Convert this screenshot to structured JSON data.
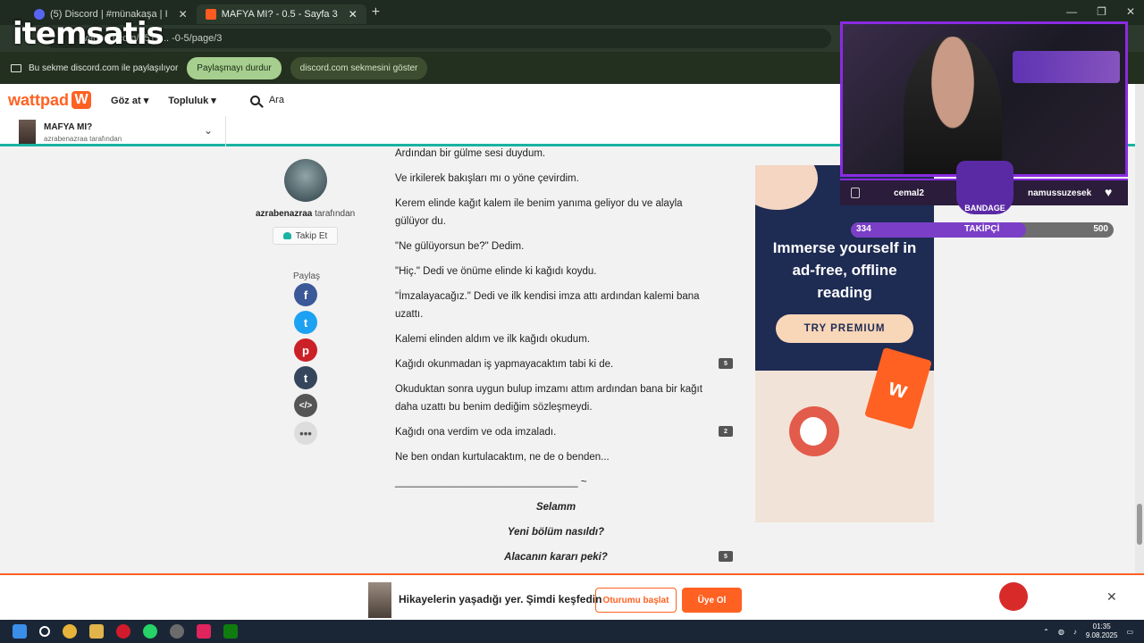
{
  "browser": {
    "tabs": [
      {
        "label": "(5) Discord | #münakaşa | I",
        "active": false
      },
      {
        "label": "MAFYA MI? - 0.5 - Sayfa 3",
        "active": true
      }
    ],
    "address": "wattpad.com/1514... -0-5/page/3",
    "overlay_logo": "itemsatis",
    "share_notice": "Bu sekme discord.com ile paylaşılıyor",
    "stop_sharing": "Paylaşmayı durdur",
    "show_tab": "discord.com sekmesini göster"
  },
  "nav": {
    "logo": "wattpad",
    "browse": "Göz at",
    "community": "Topluluk",
    "search_placeholder": "Ara"
  },
  "story_header": {
    "title": "MAFYA MI?",
    "byline": "azrabenazraa tarafından"
  },
  "author": {
    "name": "azrabenazraa",
    "suffix": " tarafından",
    "follow": "Takip Et",
    "share_label": "Paylaş"
  },
  "paragraphs": [
    {
      "text": "Ardından bir gülme sesi duydum.",
      "comments": ""
    },
    {
      "text": "Ve irkilerek bakışları mı o yöne çevirdim.",
      "comments": ""
    },
    {
      "text": "Kerem elinde kağıt kalem ile benim yanıma geliyor du ve alayla gülüyor du.",
      "comments": ""
    },
    {
      "text": "\"Ne gülüyorsun be?\" Dedim.",
      "comments": ""
    },
    {
      "text": "\"Hiç.\" Dedi ve önüme elinde ki kağıdı koydu.",
      "comments": ""
    },
    {
      "text": "\"İmzalayacağız.\" Dedi ve ilk kendisi imza attı ardından kalemi bana uzattı.",
      "comments": ""
    },
    {
      "text": "Kalemi elinden aldım ve ilk kağıdı okudum.",
      "comments": ""
    },
    {
      "text": "Kağıdı okunmadan iş yapmayacaktım tabi ki de.",
      "comments": "5"
    },
    {
      "text": "Okuduktan sonra uygun bulup imzamı attım ardından bana bir kağıt daha uzattı bu benim dediğim sözleşmeydi.",
      "comments": ""
    },
    {
      "text": "Kağıdı ona verdim ve oda imzaladı.",
      "comments": "2"
    },
    {
      "text": "Ne ben ondan kurtulacaktım, ne de o benden...",
      "comments": ""
    },
    {
      "text": "________________________________ ~",
      "comments": ""
    },
    {
      "text": "Selamm",
      "comments": ""
    },
    {
      "text": "Yeni bölüm nasıldı?",
      "comments": ""
    },
    {
      "text": "Alacanın kararı peki?",
      "comments": "5"
    }
  ],
  "ad": {
    "headline": "Immerse yourself in ad-free, offline reading",
    "cta": "TRY PREMIUM"
  },
  "bottom_bar": {
    "promo": "Hikayelerin yaşadığı yer. Şimdi keşfedin",
    "start_reading": "Oturumu başlat",
    "join": "Üye Ol"
  },
  "stream": {
    "user_left": "cemal2",
    "user_right": "namussuzesek",
    "badge": "BANDAGE",
    "followers_current": "334",
    "followers_label": "TAKİPÇİ",
    "followers_goal": "500",
    "progress": 0.668
  },
  "taskbar": {
    "time": "01:35",
    "date": "9.08.2025"
  },
  "colors": {
    "wattpad_orange": "#ff6122",
    "teal": "#19b3a3",
    "stream_purple": "#8a2be2"
  }
}
